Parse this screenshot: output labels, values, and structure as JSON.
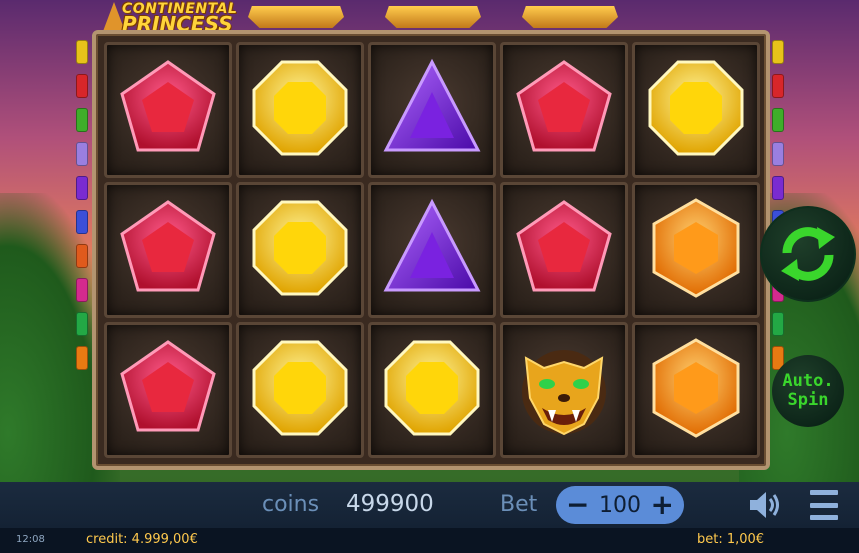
{
  "game": {
    "logo_line1": "CONTINENTAL",
    "logo_line2": "PRINCESS"
  },
  "reels": {
    "symbols": [
      [
        "red-pentagon-gem",
        "yellow-octagon-gem",
        "purple-triangle-gem",
        "red-pentagon-gem",
        "yellow-octagon-gem"
      ],
      [
        "red-pentagon-gem",
        "yellow-octagon-gem",
        "purple-triangle-gem",
        "red-pentagon-gem",
        "orange-hexagon-gem"
      ],
      [
        "red-pentagon-gem",
        "yellow-octagon-gem",
        "yellow-octagon-gem",
        "golden-jaguar-head",
        "orange-hexagon-gem"
      ]
    ]
  },
  "controls": {
    "autospin_line1": "Auto.",
    "autospin_line2": "Spin",
    "spin_icon": "refresh-arrows-icon"
  },
  "bar": {
    "coins_label": "coins",
    "coins_value": "499900",
    "bet_label": "Bet",
    "bet_value": "100",
    "minus": "−",
    "plus": "+"
  },
  "status": {
    "time": "12:08",
    "credit": "credit: 4.999,00€",
    "bet": "bet: 1,00€"
  },
  "colors": {
    "accent_green": "#3ad62c",
    "bet_pill": "#5b8cd8",
    "status_text": "#ffc94d"
  },
  "markers": {
    "left": [
      "#e8c21a",
      "#d8262a",
      "#3fae2a",
      "#9a7fe0",
      "#7a2bd1",
      "#3b4fd8",
      "#e05a1c",
      "#d42a8e",
      "#23a845",
      "#e87a12"
    ],
    "right": [
      "#e8c21a",
      "#d8262a",
      "#3fae2a",
      "#9a7fe0",
      "#7a2bd1",
      "#3b4fd8",
      "#e05a1c",
      "#d42a8e",
      "#23a845",
      "#e87a12"
    ]
  }
}
